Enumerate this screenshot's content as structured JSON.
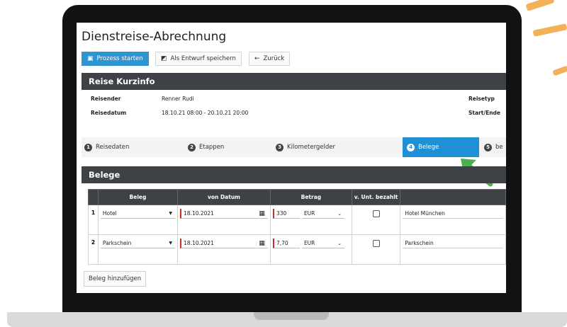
{
  "page": {
    "title": "Dienstreise-Abrechnung"
  },
  "toolbar": {
    "start": "Prozess starten",
    "draft": "Als Entwurf speichern",
    "back": "Zurück"
  },
  "kurzinfo": {
    "title": "Reise Kurzinfo",
    "reisender_label": "Reisender",
    "reisender_value": "Renner Rudi",
    "reisedatum_label": "Reisedatum",
    "reisedatum_value": "18.10.21 08:00 - 20.10.21 20:00",
    "reisetyp_label": "Reisetyp",
    "startende_label": "Start/Ende"
  },
  "steps": [
    {
      "num": "1",
      "label": "Reisedaten"
    },
    {
      "num": "2",
      "label": "Etappen"
    },
    {
      "num": "3",
      "label": "Kilometergelder"
    },
    {
      "num": "4",
      "label": "Belege"
    },
    {
      "num": "5",
      "label": "be"
    }
  ],
  "active_step": 4,
  "belege": {
    "title": "Belege",
    "headers": [
      "Beleg",
      "von Datum",
      "Betrag",
      "v. Unt. bezahlt",
      ""
    ],
    "rows": [
      {
        "nr": "1",
        "beleg": "Hotel",
        "datum": "18.10.2021",
        "betrag": "330",
        "waehrung": "EUR",
        "bezahlt": false,
        "beschreibung": "Hotel München"
      },
      {
        "nr": "2",
        "beleg": "Parkschein",
        "datum": "18.10.2021",
        "betrag": "7,70",
        "waehrung": "EUR",
        "bezahlt": false,
        "beschreibung": "Parkschein"
      }
    ],
    "add_button": "Beleg hinzufügen"
  },
  "colors": {
    "accent": "#2e95d3",
    "header_dark": "#3e4145",
    "arrow": "#4caf50",
    "required": "#c9302c"
  }
}
